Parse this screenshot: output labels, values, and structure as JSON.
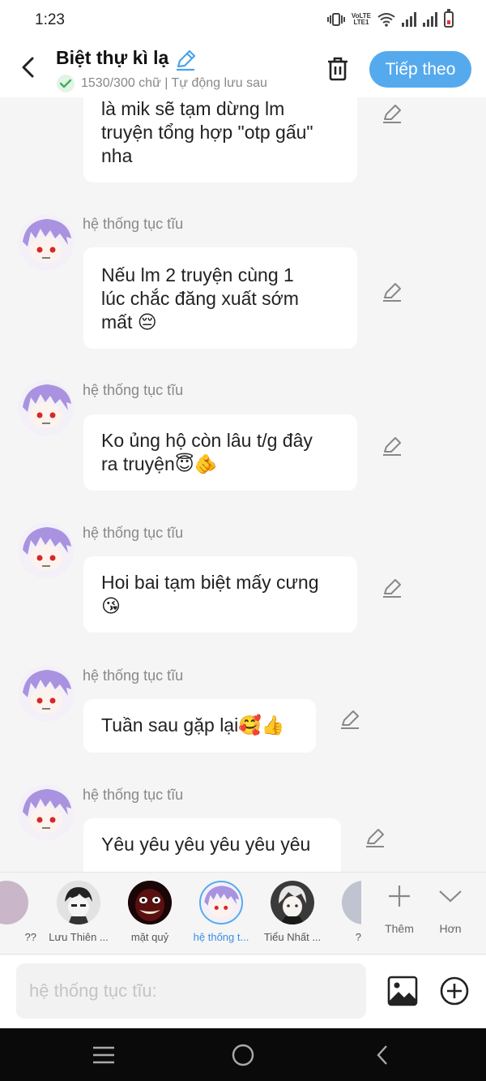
{
  "status_bar": {
    "time": "1:23",
    "volte_line1": "VoLTE",
    "volte_line2": "LTE1"
  },
  "header": {
    "title": "Biệt thự kì lạ",
    "word_count": "1530/300 chữ | Tự động lưu sau",
    "next_label": "Tiếp theo"
  },
  "messages": [
    {
      "sender": "",
      "text": "là mik sẽ tạm dừng lm\ntruyện tổng hợp \"otp gấu\"\nnha",
      "emoji": ""
    },
    {
      "sender": "hệ thống tục tĩu",
      "text": "Nếu lm 2 truyện cùng 1\nlúc chắc đăng xuất sớm\nmất ",
      "emoji": "😔"
    },
    {
      "sender": "hệ thống tục tĩu",
      "text": "Ko ủng hộ còn lâu t/g đây\nra truyện",
      "emoji": "😇🫵"
    },
    {
      "sender": "hệ thống tục tĩu",
      "text": "Hoi bai tạm biệt mấy cưng\n",
      "emoji": "😘"
    },
    {
      "sender": "hệ thống tục tĩu",
      "text": "Tuần sau gặp lại",
      "emoji": "🥰👍"
    },
    {
      "sender": "hệ thống tục tĩu",
      "text": "Yêu yêu yêu yêu yêu yêu",
      "emoji": ""
    }
  ],
  "characters": [
    {
      "name": "??",
      "avatar_color": "#c9b7c9"
    },
    {
      "name": "Lưu Thiên ...",
      "avatar_color": "#d8d8d8"
    },
    {
      "name": "mặt quỷ",
      "avatar_color": "#2a0a0a"
    },
    {
      "name": "hệ thống t...",
      "avatar_color": "#b9a6e6",
      "active": true
    },
    {
      "name": "Tiểu Nhất ...",
      "avatar_color": "#bbbbbb"
    },
    {
      "name": "?",
      "avatar_color": "#c0c4d0"
    }
  ],
  "strip_actions": {
    "add_label": "Thêm",
    "more_label": "Hơn"
  },
  "input": {
    "placeholder": "hệ thống tục tĩu:"
  },
  "colors": {
    "accent": "#55aaee",
    "bg": "#f5f5f5",
    "bubble": "#ffffff"
  }
}
